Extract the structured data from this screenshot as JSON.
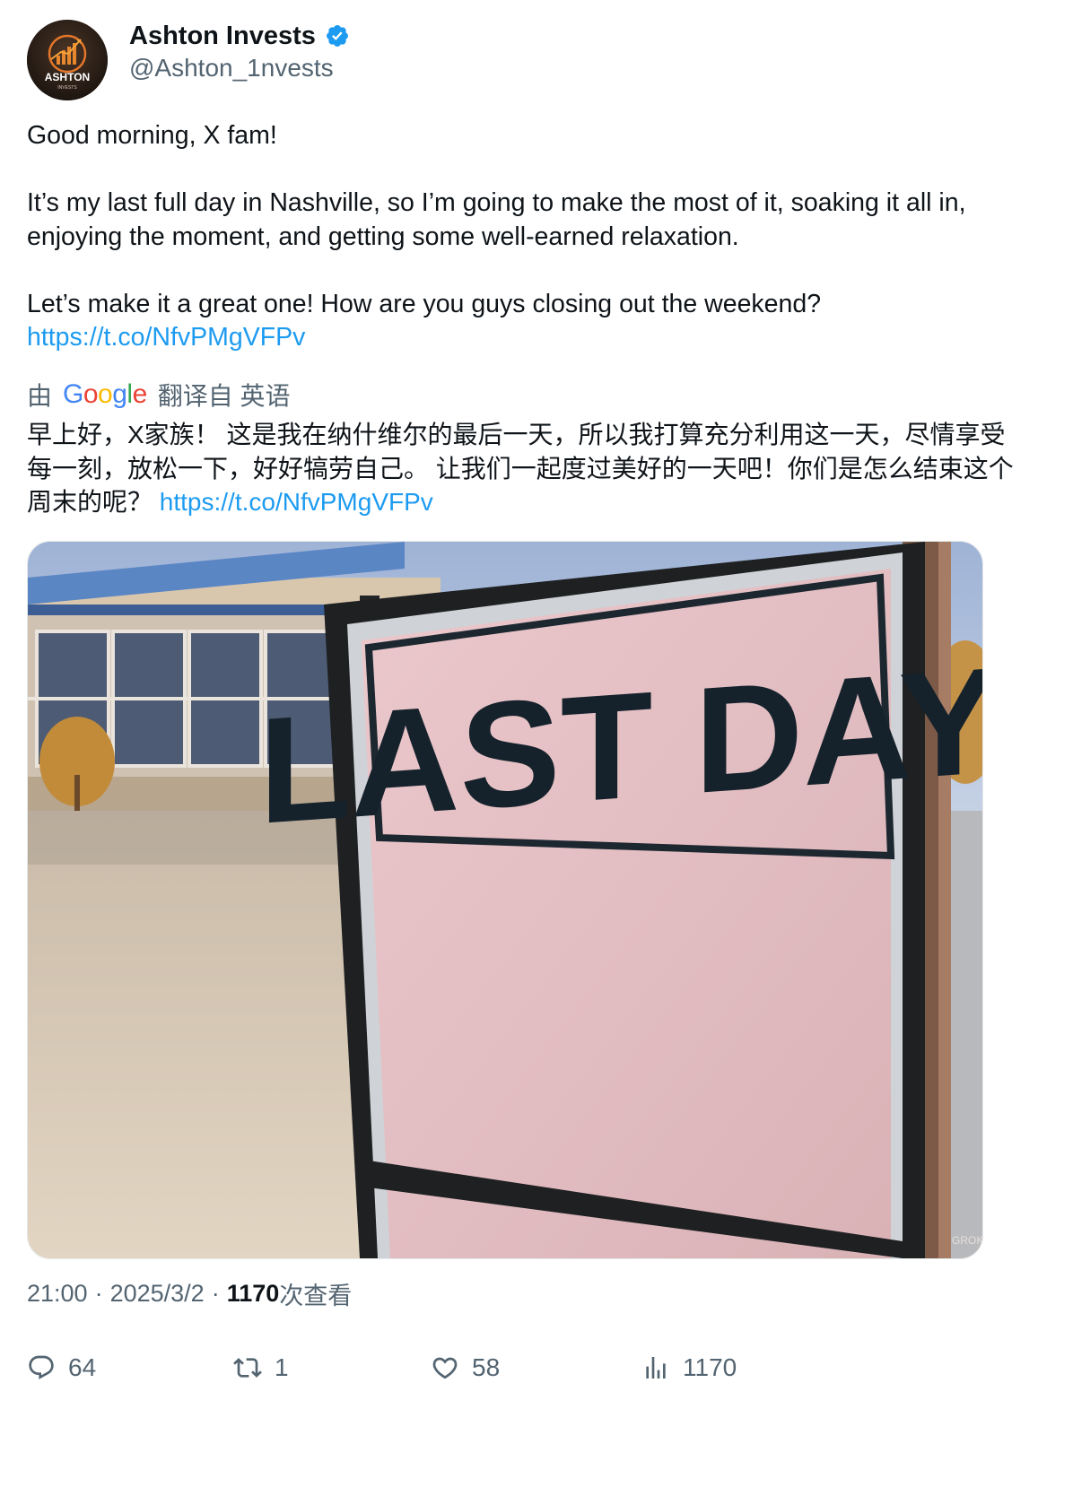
{
  "author": {
    "display_name": "Ashton Invests",
    "handle": "@Ashton_1nvests",
    "verified": true,
    "avatar_text": "ASHTON",
    "avatar_subtext": "INVESTS"
  },
  "post": {
    "line1": "Good morning, X fam!",
    "paragraph2": "It’s my last full day in Nashville, so I’m going to make the most of it, soaking it all in, enjoying the moment, and getting some well-earned relaxation.",
    "paragraph3": "Let’s make it a great one! How are you guys closing out the weekend?",
    "link": "https://t.co/NfvPMgVFPv"
  },
  "translation": {
    "by_prefix": "由",
    "provider_letters": [
      "G",
      "o",
      "o",
      "g",
      "l",
      "e"
    ],
    "suffix": "翻译自 英语",
    "text": "早上好，X家族！ 这是我在纳什维尔的最后一天，所以我打算充分利用这一天，尽情享受每一刻，放松一下，好好犒劳自己。 让我们一起度过美好的一天吧！你们是怎么结束这个周末的呢？",
    "link": "https://t.co/NfvPMgVFPv"
  },
  "media": {
    "sign_text": "LAST DAY",
    "watermark": "GROK"
  },
  "meta": {
    "time": "21:00",
    "date": "2025/3/2",
    "views_count": "1170",
    "views_label": "次查看",
    "separator": "·"
  },
  "actions": {
    "replies": "64",
    "reposts": "1",
    "likes": "58",
    "views": "1170"
  },
  "colors": {
    "link": "#1d9bf0",
    "secondary_text": "#536471",
    "verified_badge": "#1d9bf0"
  }
}
